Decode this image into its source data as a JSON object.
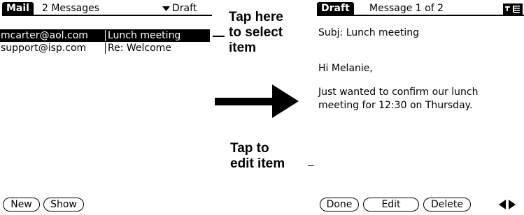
{
  "left_screen": {
    "app_tab": "Mail",
    "count_text": "2 Messages",
    "category": "Draft",
    "rows": [
      {
        "from": "mcarter@aol.com",
        "subject": "Lunch meeting",
        "selected": true
      },
      {
        "from": "support@isp.com",
        "subject": "Re: Welcome",
        "selected": false
      }
    ],
    "buttons": {
      "new": "New",
      "show": "Show"
    }
  },
  "callouts": {
    "select": [
      "Tap here",
      "to select",
      "item"
    ],
    "edit": [
      "Tap to",
      "edit item"
    ]
  },
  "right_screen": {
    "app_tab": "Draft",
    "position_text": "Message 1 of 2",
    "subject_line": "Subj: Lunch meeting",
    "body_lines": [
      "Hi Melanie,",
      "",
      "Just wanted to confirm our lunch",
      "meeting for 12:30 on Thursday."
    ],
    "buttons": {
      "done": "Done",
      "edit": "Edit",
      "delete": "Delete"
    }
  },
  "icons": {
    "category_dropdown": "triangle-down-icon",
    "font_toggle": "font-icon",
    "scroll_arrows": "left-right-arrows-icon",
    "transition_arrow": "right-arrow-icon"
  }
}
